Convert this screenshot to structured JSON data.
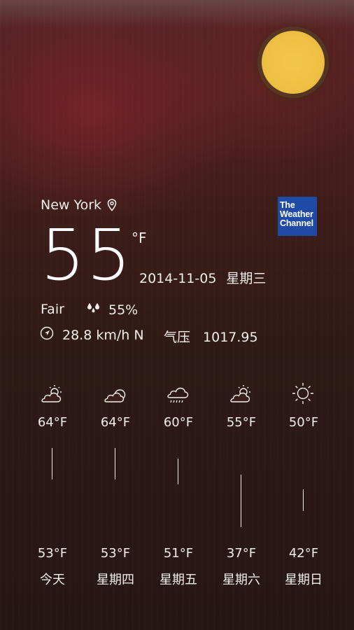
{
  "current": {
    "location": "New York",
    "temperature": "55",
    "unit": "°F",
    "date": "2014-11-05",
    "weekday": "星期三",
    "condition": "Fair",
    "humidity": "55%",
    "wind": "28.8 km/h N",
    "pressure_label": "气压",
    "pressure_value": "1017.95"
  },
  "brand": {
    "line1": "The",
    "line2": "Weather",
    "line3": "Channel",
    "color": "#1f4aa6"
  },
  "forecast": [
    {
      "day": "今天",
      "high": "64°F",
      "low": "53°F",
      "icon": "partly-cloudy-sun-icon"
    },
    {
      "day": "星期四",
      "high": "64°F",
      "low": "53°F",
      "icon": "cloudy-icon"
    },
    {
      "day": "星期五",
      "high": "60°F",
      "low": "51°F",
      "icon": "rain-cloud-icon"
    },
    {
      "day": "星期六",
      "high": "55°F",
      "low": "37°F",
      "icon": "partly-cloudy-sun-icon"
    },
    {
      "day": "星期日",
      "high": "50°F",
      "low": "42°F",
      "icon": "sun-icon"
    }
  ],
  "colors": {
    "sun": "#eec043",
    "text": "#f2eeea"
  }
}
